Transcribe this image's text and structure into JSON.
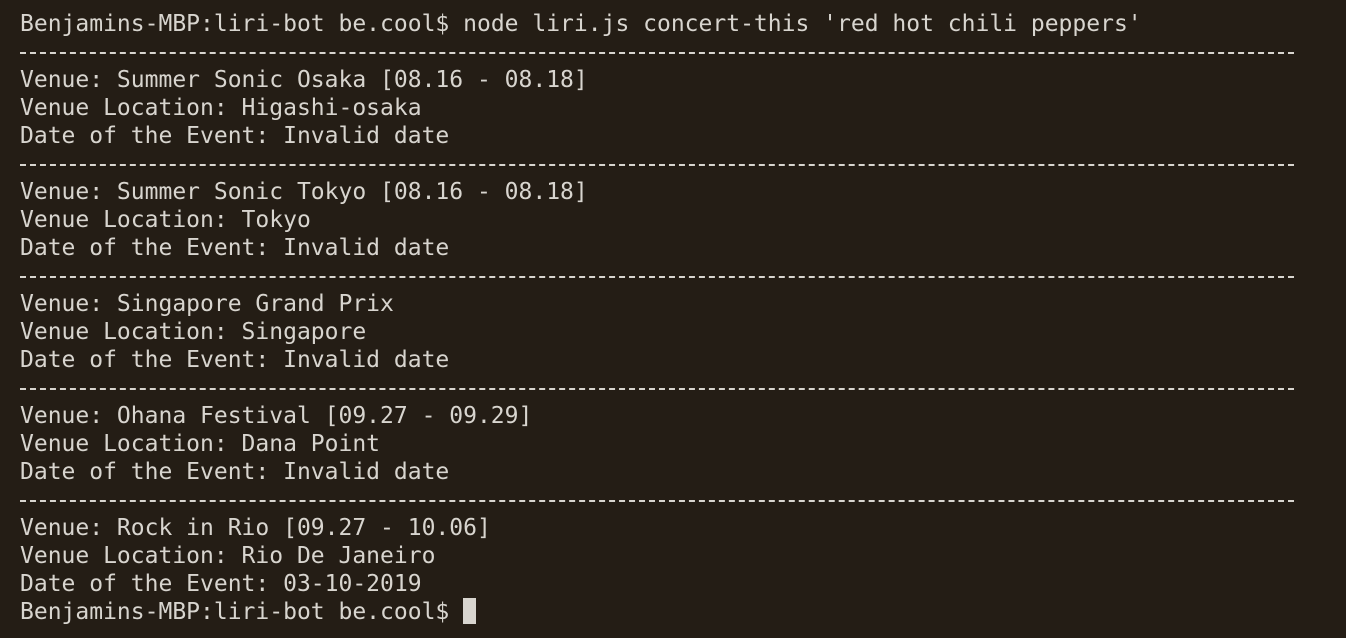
{
  "terminal": {
    "prompt": "Benjamins-MBP:liri-bot be.cool$",
    "command": "node liri.js concert-this 'red hot chili peppers'",
    "events": [
      {
        "venue": "Venue: Summer Sonic Osaka [08.16 - 08.18]",
        "location": "Venue Location: Higashi-osaka",
        "date": "Date of the Event: Invalid date"
      },
      {
        "venue": "Venue: Summer Sonic Tokyo [08.16 - 08.18]",
        "location": "Venue Location: Tokyo",
        "date": "Date of the Event: Invalid date"
      },
      {
        "venue": "Venue: Singapore Grand Prix",
        "location": "Venue Location: Singapore",
        "date": "Date of the Event: Invalid date"
      },
      {
        "venue": "Venue: Ohana Festival [09.27 - 09.29]",
        "location": "Venue Location: Dana Point",
        "date": "Date of the Event: Invalid date"
      },
      {
        "venue": "Venue: Rock in Rio [09.27 - 10.06]",
        "location": "Venue Location: Rio De Janeiro",
        "date": "Date of the Event: 03-10-2019"
      }
    ]
  },
  "colors": {
    "background": "#241d15",
    "foreground": "#d8d5cf"
  }
}
